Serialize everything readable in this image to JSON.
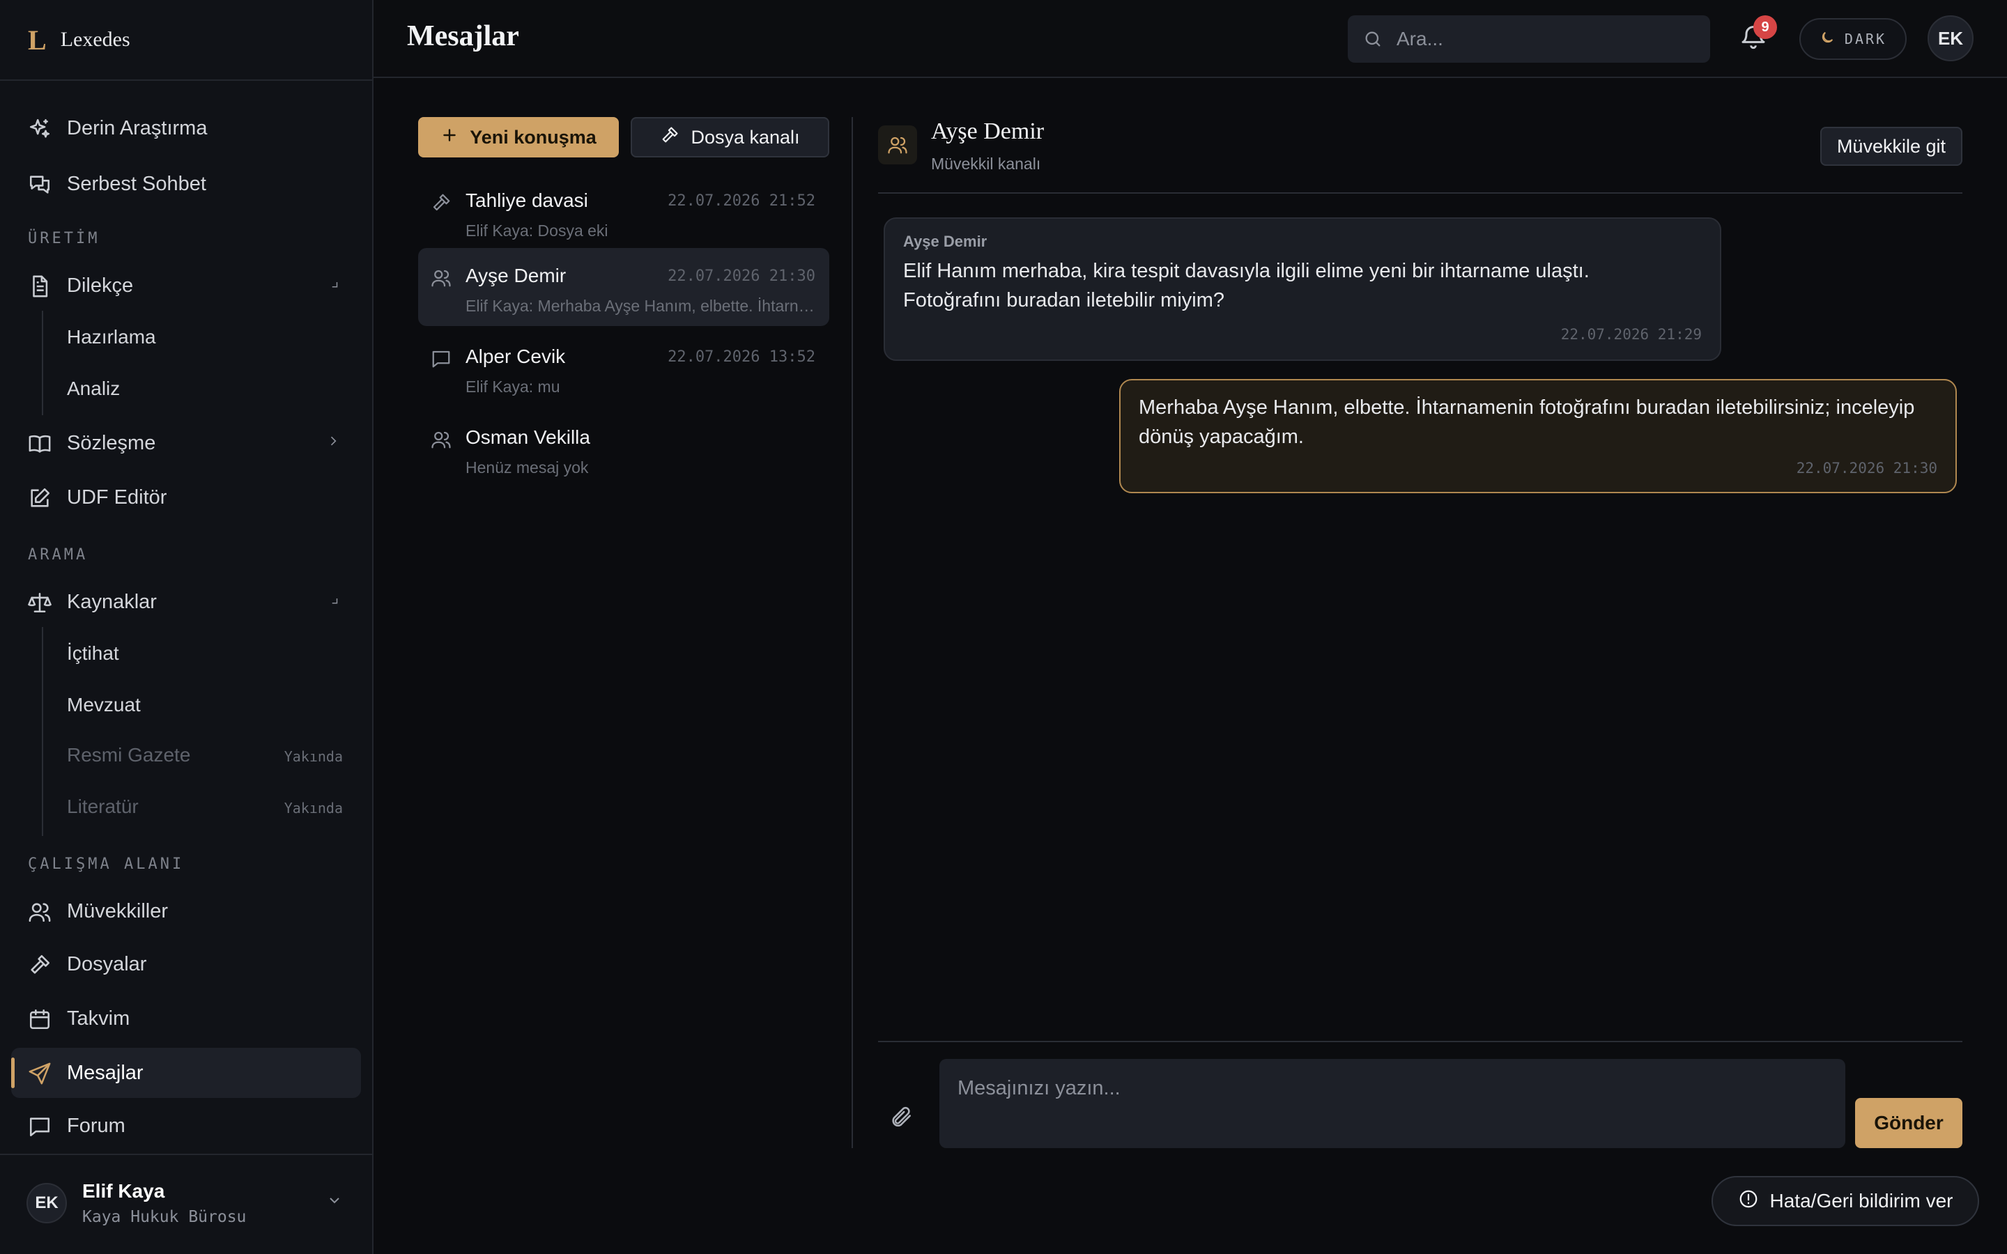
{
  "app": {
    "brand_logo": "L",
    "brand_name": "Lexedes"
  },
  "sidebar": {
    "top_items": [
      {
        "label": "Derin Araştırma",
        "icon": "sparkles-icon"
      },
      {
        "label": "Serbest Sohbet",
        "icon": "chat-bubbles-icon"
      }
    ],
    "sections": [
      {
        "title": "ÜRETİM"
      },
      {
        "title": "ARAMA"
      },
      {
        "title": "ÇALIŞMA ALANI"
      }
    ],
    "uretim": {
      "dilekce": {
        "label": "Dilekçe",
        "icon": "document-icon",
        "subitems": [
          {
            "label": "Hazırlama"
          },
          {
            "label": "Analiz"
          }
        ]
      },
      "sozlesme": {
        "label": "Sözleşme",
        "icon": "book-icon"
      },
      "udf": {
        "label": "UDF Editör",
        "icon": "edit-icon"
      }
    },
    "arama": {
      "kaynaklar": {
        "label": "Kaynaklar",
        "icon": "scale-icon",
        "subitems": [
          {
            "label": "İçtihat"
          },
          {
            "label": "Mevzuat"
          },
          {
            "label": "Resmi Gazete",
            "badge": "Yakında"
          },
          {
            "label": "Literatür",
            "badge": "Yakında"
          }
        ]
      }
    },
    "workspace": [
      {
        "label": "Müvekkiller",
        "icon": "users-icon"
      },
      {
        "label": "Dosyalar",
        "icon": "gavel-icon"
      },
      {
        "label": "Takvim",
        "icon": "calendar-icon"
      },
      {
        "label": "Mesajlar",
        "icon": "send-icon",
        "active": true
      },
      {
        "label": "Forum",
        "icon": "message-square-icon"
      }
    ],
    "user": {
      "initials": "EK",
      "name": "Elif Kaya",
      "org": "Kaya Hukuk Bürosu"
    }
  },
  "header": {
    "title": "Mesajlar",
    "search_placeholder": "Ara...",
    "notification_count": "9",
    "theme_label": "DARK",
    "avatar_initials": "EK"
  },
  "conversations": {
    "new_button": "Yeni konuşma",
    "file_channel_button": "Dosya kanalı",
    "items": [
      {
        "name": "Tahliye davasi",
        "time": "22.07.2026 21:52",
        "preview": "Elif Kaya: Dosya eki",
        "icon": "gavel-icon"
      },
      {
        "name": "Ayşe Demir",
        "time": "22.07.2026 21:30",
        "preview": "Elif Kaya: Merhaba Ayşe Hanım, elbette. İhtarnamenin fotoğrafını buradan iletebilirsiniz",
        "icon": "users-icon",
        "selected": true
      },
      {
        "name": "Alper Cevik",
        "time": "22.07.2026 13:52",
        "preview": "Elif Kaya: mu",
        "icon": "message-square-icon"
      },
      {
        "name": "Osman Vekilla",
        "time": "",
        "preview": "Henüz mesaj yok",
        "icon": "users-icon"
      }
    ]
  },
  "chat": {
    "name": "Ayşe Demir",
    "subtitle": "Müvekkil kanalı",
    "goto_button": "Müvekkile git",
    "messages": [
      {
        "direction": "in",
        "sender": "Ayşe Demir",
        "text": "Elif Hanım merhaba, kira tespit davasıyla ilgili elime yeni bir ihtarname ulaştı. Fotoğrafını buradan iletebilir miyim?",
        "time": "22.07.2026 21:29"
      },
      {
        "direction": "out",
        "text": "Merhaba Ayşe Hanım, elbette. İhtarnamenin fotoğrafını buradan iletebilirsiniz; inceleyip dönüş yapacağım.",
        "time": "22.07.2026 21:30"
      }
    ],
    "compose_placeholder": "Mesajınızı yazın...",
    "send_button": "Gönder"
  },
  "feedback_button": "Hata/Geri bildirim ver",
  "colors": {
    "accent": "#cfa266",
    "background": "#0b0c0f",
    "badge": "#d64545"
  }
}
